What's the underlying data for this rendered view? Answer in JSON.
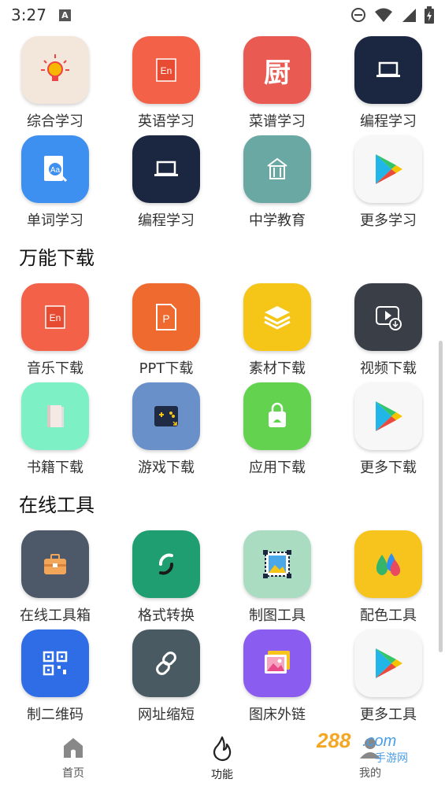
{
  "status": {
    "time": "3:27",
    "notif_letter": "A"
  },
  "colors": {
    "accent": "#333333",
    "scrollbar": "#cfcfcf"
  },
  "rows": [
    [
      {
        "label": "综合学习",
        "icon": "lightbulb-icon",
        "bg": "#f3e6da"
      },
      {
        "label": "英语学习",
        "icon": "en-book-icon",
        "bg": "#f26148"
      },
      {
        "label": "菜谱学习",
        "icon": "kitchen-char-icon",
        "bg": "#e85a52",
        "glyph": "厨"
      },
      {
        "label": "编程学习",
        "icon": "laptop-icon",
        "bg": "#1b2641"
      }
    ],
    [
      {
        "label": "单词学习",
        "icon": "dictionary-search-icon",
        "bg": "#3d8ff0"
      },
      {
        "label": "编程学习",
        "icon": "laptop-icon",
        "bg": "#1b2641"
      },
      {
        "label": "中学教育",
        "icon": "school-building-icon",
        "bg": "#6aa8a4"
      },
      {
        "label": "更多学习",
        "icon": "play-store-icon",
        "bg": "#f7f7f7"
      }
    ]
  ],
  "sections": [
    {
      "title": "万能下载",
      "rows": [
        [
          {
            "label": "音乐下载",
            "icon": "en-book-icon",
            "bg": "#f26148"
          },
          {
            "label": "PPT下载",
            "icon": "ppt-file-icon",
            "bg": "#ee6a2f"
          },
          {
            "label": "素材下载",
            "icon": "layers-icon",
            "bg": "#f5c518"
          },
          {
            "label": "视频下载",
            "icon": "video-download-icon",
            "bg": "#3a3f47"
          }
        ],
        [
          {
            "label": "书籍下载",
            "icon": "book-icon",
            "bg": "#7ef0c6"
          },
          {
            "label": "游戏下载",
            "icon": "gamepad-icon",
            "bg": "#6a90c9"
          },
          {
            "label": "应用下载",
            "icon": "shopping-bag-icon",
            "bg": "#62d24f"
          },
          {
            "label": "更多下载",
            "icon": "play-store-icon",
            "bg": "#f7f7f7"
          }
        ]
      ]
    },
    {
      "title": "在线工具",
      "rows": [
        [
          {
            "label": "在线工具箱",
            "icon": "toolbox-icon",
            "bg": "#4d5869"
          },
          {
            "label": "格式转换",
            "icon": "convert-icon",
            "bg": "#1f9e72"
          },
          {
            "label": "制图工具",
            "icon": "image-frame-icon",
            "bg": "#a9dcc0"
          },
          {
            "label": "配色工具",
            "icon": "color-drops-icon",
            "bg": "#f7c41e"
          }
        ],
        [
          {
            "label": "制二维码",
            "icon": "qr-code-icon",
            "bg": "#2f6de6"
          },
          {
            "label": "网址缩短",
            "icon": "link-icon",
            "bg": "#4a5a63"
          },
          {
            "label": "图床外链",
            "icon": "gallery-icon",
            "bg": "#8a5cf0"
          },
          {
            "label": "更多工具",
            "icon": "play-store-icon",
            "bg": "#f7f7f7"
          }
        ]
      ]
    }
  ],
  "nav": [
    {
      "label": "首页",
      "icon": "home-icon"
    },
    {
      "label": "功能",
      "icon": "flame-icon"
    },
    {
      "label": "我的",
      "icon": "profile-icon"
    }
  ],
  "watermark": {
    "brand": "288.com",
    "sub": "手游网"
  }
}
